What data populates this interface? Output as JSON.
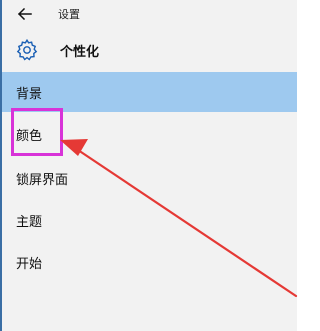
{
  "window": {
    "back_icon": "arrow-left-icon",
    "title": "设置"
  },
  "header": {
    "icon": "gear-icon",
    "title": "个性化"
  },
  "nav": {
    "items": [
      {
        "label": "背景",
        "selected": true
      },
      {
        "label": "颜色",
        "selected": false
      },
      {
        "label": "锁屏界面",
        "selected": false
      },
      {
        "label": "主题",
        "selected": false
      },
      {
        "label": "开始",
        "selected": false
      }
    ]
  },
  "colors": {
    "selected_background": "#9ec9ef",
    "panel_background": "#f2f2f2",
    "highlight_box": "#d833d8",
    "annotation_arrow": "#e53935"
  }
}
